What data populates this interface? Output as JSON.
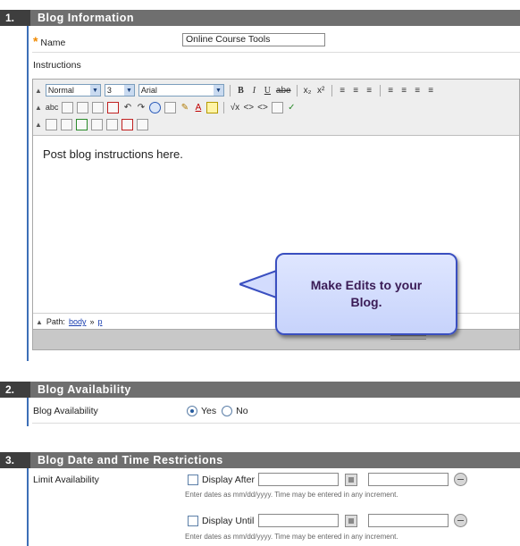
{
  "section1": {
    "number": "1.",
    "title": "Blog Information",
    "name_label": "Name",
    "required_marker": "*",
    "name_value": "Online Course Tools",
    "instructions_label": "Instructions",
    "toolbar": {
      "format_select": "Normal",
      "size_select": "3",
      "font_select": "Arial",
      "bold": "B",
      "italic": "I",
      "underline": "U",
      "strike": "abe",
      "subscript": "x₂",
      "superscript": "x²",
      "spell": "abc"
    },
    "editor_content": "Post blog instructions here.",
    "path_label": "Path:",
    "path_body": "body",
    "path_sep": "»",
    "path_p": "p"
  },
  "callout": {
    "line1": "Make Edits to your",
    "line2": "Blog."
  },
  "section2": {
    "number": "2.",
    "title": "Blog Availability",
    "label": "Blog Availability",
    "options": [
      "Yes",
      "No"
    ],
    "selected": "Yes"
  },
  "section3": {
    "number": "3.",
    "title": "Blog Date and Time Restrictions",
    "label": "Limit Availability",
    "display_after": "Display After",
    "display_until": "Display Until",
    "hint": "Enter dates as mm/dd/yyyy. Time may be entered in any increment."
  },
  "colors": {
    "header_bg": "#6f6f6f",
    "number_bg": "#3e3e3e",
    "accent_bar": "#3d6fb7",
    "required": "#f08a00",
    "callout_border": "#3a4fc0",
    "callout_text": "#3a1b55"
  }
}
